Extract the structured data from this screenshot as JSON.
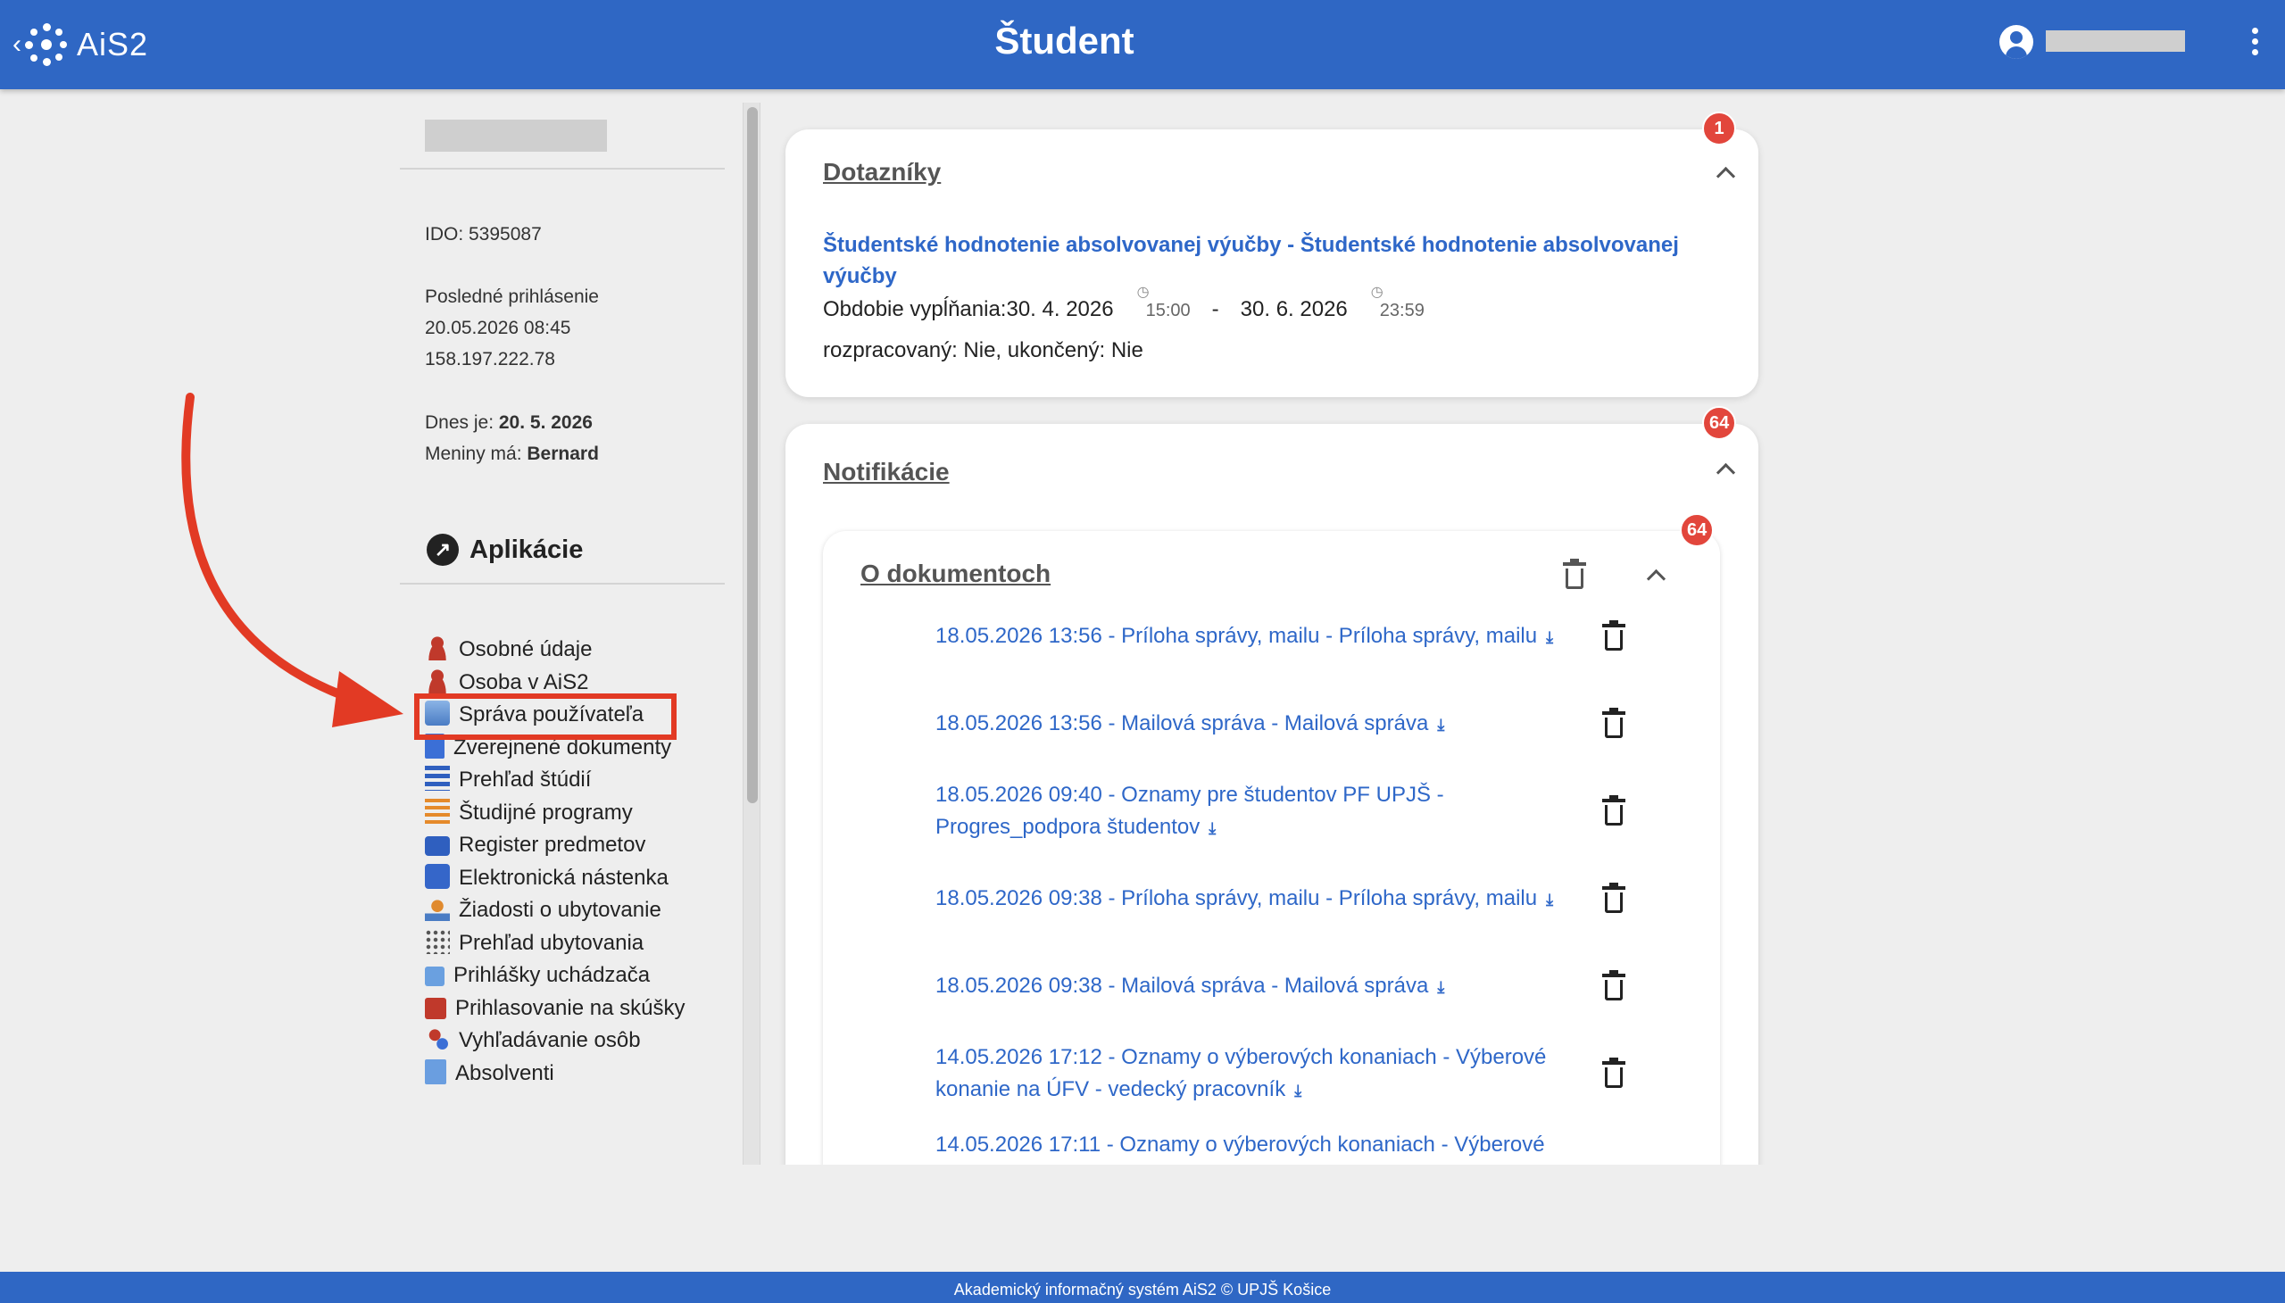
{
  "header": {
    "brand": "AiS2",
    "title": "Študent"
  },
  "sidebar": {
    "ido": "IDO: 5395087",
    "last_login_label": "Posledné prihlásenie",
    "last_login_time": "20.05.2026 08:45",
    "last_login_ip": "158.197.222.78",
    "today_label": "Dnes je: ",
    "today_value": "20. 5. 2026",
    "nameday_label": "Meniny má: ",
    "nameday_value": "Bernard",
    "apps_title": "Aplikácie",
    "apps": [
      {
        "label": "Osobné údaje",
        "icon": "person-icon"
      },
      {
        "label": "Osoba v AiS2",
        "icon": "person-icon"
      },
      {
        "label": "Správa používateľa",
        "icon": "users-icon"
      },
      {
        "label": "Zverejnené dokumenty",
        "icon": "document-icon"
      },
      {
        "label": "Prehľad štúdií",
        "icon": "list-icon"
      },
      {
        "label": "Študijné programy",
        "icon": "list-icon"
      },
      {
        "label": "Register predmetov",
        "icon": "register-icon"
      },
      {
        "label": "Elektronická nástenka",
        "icon": "board-icon"
      },
      {
        "label": "Žiadosti o ubytovanie",
        "icon": "dorm-icon"
      },
      {
        "label": "Prehľad ubytovania",
        "icon": "grid-icon"
      },
      {
        "label": "Prihlášky uchádzača",
        "icon": "check-icon"
      },
      {
        "label": "Prihlasovanie na skúšky",
        "icon": "calendar-icon"
      },
      {
        "label": "Vyhľadávanie osôb",
        "icon": "search-persons-icon"
      },
      {
        "label": "Absolventi",
        "icon": "graduate-icon"
      }
    ]
  },
  "surveys": {
    "title": "Dotazníky",
    "badge": "1",
    "link": "Študentské hodnotenie absolvovanej výučby - Študentské hodnotenie absolvovanej výučby",
    "period_label": "Obdobie vypĺňania: ",
    "date_from": "30. 4. 2026",
    "time_from": "15:00",
    "separator": "-",
    "date_to": "30. 6. 2026",
    "time_to": "23:59",
    "status": "rozpracovaný: Nie, ukončený: Nie"
  },
  "notifications": {
    "title": "Notifikácie",
    "badge": "64",
    "group": {
      "title": "O dokumentoch",
      "badge": "64",
      "items": [
        "18.05.2026 13:56 - Príloha správy, mailu - Príloha správy, mailu",
        "18.05.2026 13:56 - Mailová správa - Mailová správa",
        "18.05.2026 09:40 - Oznamy pre študentov PF UPJŠ - Progres_podpora študentov",
        "18.05.2026 09:38 - Príloha správy, mailu - Príloha správy, mailu",
        "18.05.2026 09:38 - Mailová správa - Mailová správa",
        "14.05.2026 17:12 - Oznamy o výberových konaniach - Výberové konanie na ÚFV - vedecký pracovník",
        "14.05.2026 17:11 - Oznamy o výberových konaniach - Výberové"
      ]
    }
  },
  "footer": "Akademický informačný systém AiS2 © UPJŠ Košice",
  "colors": {
    "header": "#2f67c4",
    "link": "#2e67c8",
    "badge": "#e2463c",
    "highlight": "#e23a24"
  }
}
